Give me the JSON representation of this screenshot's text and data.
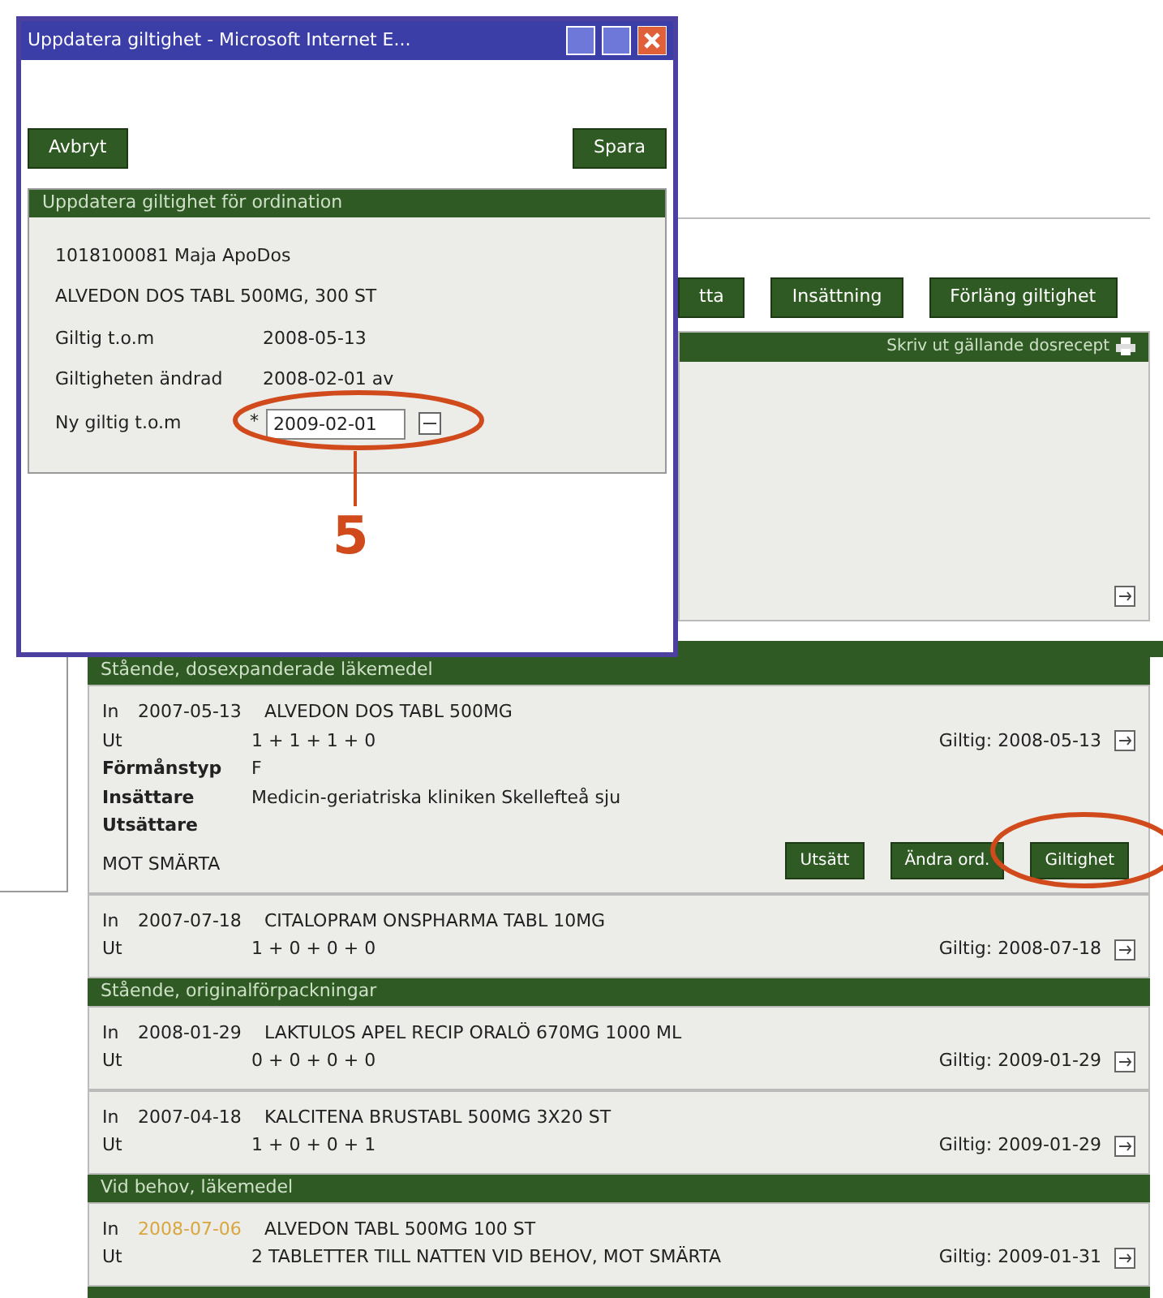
{
  "dialog": {
    "title": "Uppdatera giltighet - Microsoft Internet E...",
    "buttons": [
      "Avbryt",
      "Spara"
    ],
    "section_title": "Uppdatera giltighet för ordination",
    "patient": "1018100081  Maja ApoDos",
    "drug": "ALVEDON DOS TABL 500MG, 300 ST",
    "fields": [
      {
        "label": "Giltig t.o.m",
        "value": "2008-05-13"
      },
      {
        "label": "Giltigheten ändrad",
        "value": "2008-02-01  av"
      }
    ],
    "new_date": {
      "label": "Ny giltig t.o.m",
      "required_mark": "*",
      "value": "2009-02-01"
    }
  },
  "toolbar": {
    "buttons": [
      "tta",
      "Insättning",
      "Förläng giltighet"
    ]
  },
  "print_panel": {
    "link": "Skriv ut gällande dosrecept"
  },
  "sections": [
    {
      "title": "Stående, dosexpanderade läkemedel",
      "rows": [
        {
          "in_label": "In",
          "in_date": "2007-05-13",
          "flagged": false,
          "drug": "ALVEDON DOS TABL 500MG",
          "out_label": "Ut",
          "dosage": "1 + 1 + 1 + 0",
          "valid": "Giltig: 2008-05-13",
          "details": [
            {
              "label": "Förmånstyp",
              "value": "F"
            },
            {
              "label": "Insättare",
              "value": "Medicin-geriatriska kliniken Skellefteå sju"
            },
            {
              "label": "Utsättare"
            }
          ],
          "note": "MOT SMÄRTA",
          "actions": [
            "Utsätt",
            "Ändra ord.",
            "Giltighet"
          ]
        },
        {
          "in_label": "In",
          "in_date": "2007-07-18",
          "flagged": false,
          "drug": "CITALOPRAM ONSPHARMA TABL 10MG",
          "out_label": "Ut",
          "dosage": "1 + 0 + 0 + 0",
          "valid": "Giltig: 2008-07-18"
        }
      ]
    },
    {
      "title": "Stående, originalförpackningar",
      "rows": [
        {
          "in_label": "In",
          "in_date": "2008-01-29",
          "flagged": false,
          "drug": "LAKTULOS APEL RECIP ORALÖ 670MG 1000 ML",
          "out_label": "Ut",
          "dosage": "0 + 0 + 0 + 0",
          "valid": "Giltig: 2009-01-29"
        },
        {
          "in_label": "In",
          "in_date": "2007-04-18",
          "flagged": false,
          "drug": "KALCITENA BRUSTABL 500MG 3X20 ST",
          "out_label": "Ut",
          "dosage": "1 + 0 + 0 + 1",
          "valid": "Giltig: 2009-01-29"
        }
      ]
    },
    {
      "title": "Vid behov, läkemedel",
      "rows": [
        {
          "in_label": "In",
          "in_date": "2008-07-06",
          "flagged": true,
          "drug": "ALVEDON TABL 500MG 100 ST",
          "out_label": "Ut",
          "dosage": "2 TABLETTER TILL NATTEN VID BEHOV, MOT SMÄRTA",
          "valid": "Giltig: 2009-01-31"
        }
      ]
    }
  ],
  "callout": {
    "label": "5"
  }
}
